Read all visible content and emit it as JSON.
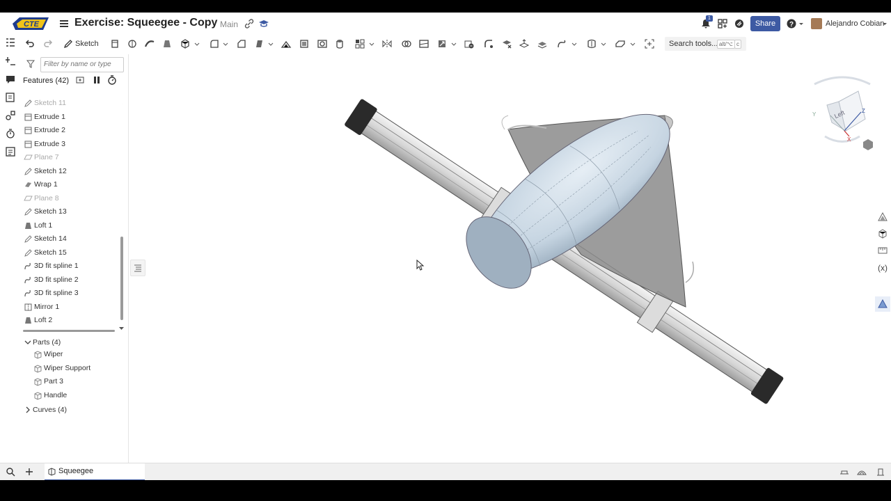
{
  "header": {
    "title": "Exercise: Squeegee - Copy",
    "branch": "Main",
    "share_label": "Share",
    "user_name": "Alejandro Cobian",
    "notification_count": "1",
    "logo_text": "CTE"
  },
  "toolbar": {
    "sketch_label": "Sketch",
    "search_label": "Search tools...",
    "shortcut_1": "alt/⌥",
    "shortcut_2": "c"
  },
  "panel": {
    "filter_placeholder": "Filter by name or type",
    "features_title": "Features (42)",
    "features": [
      {
        "label": "Sketch 11",
        "icon": "sketch-icon",
        "dim": true
      },
      {
        "label": "Extrude 1",
        "icon": "extrude-icon",
        "dim": false
      },
      {
        "label": "Extrude 2",
        "icon": "extrude-icon",
        "dim": false
      },
      {
        "label": "Extrude 3",
        "icon": "extrude-icon",
        "dim": false
      },
      {
        "label": "Plane 7",
        "icon": "plane-icon",
        "dim": true
      },
      {
        "label": "Sketch 12",
        "icon": "sketch-icon",
        "dim": false
      },
      {
        "label": "Wrap 1",
        "icon": "wrap-icon",
        "dim": false
      },
      {
        "label": "Plane 8",
        "icon": "plane-icon",
        "dim": true
      },
      {
        "label": "Sketch 13",
        "icon": "sketch-icon",
        "dim": false
      },
      {
        "label": "Loft 1",
        "icon": "loft-icon",
        "dim": false
      },
      {
        "label": "Sketch 14",
        "icon": "sketch-icon",
        "dim": false
      },
      {
        "label": "Sketch 15",
        "icon": "sketch-icon",
        "dim": false
      },
      {
        "label": "3D fit spline 1",
        "icon": "spline-icon",
        "dim": false
      },
      {
        "label": "3D fit spline 2",
        "icon": "spline-icon",
        "dim": false
      },
      {
        "label": "3D fit spline 3",
        "icon": "spline-icon",
        "dim": false
      },
      {
        "label": "Mirror 1",
        "icon": "mirror-icon",
        "dim": false
      },
      {
        "label": "Loft 2",
        "icon": "loft-icon",
        "dim": false
      }
    ],
    "parts_label": "Parts (4)",
    "parts": [
      "Wiper",
      "Wiper Support",
      "Part 3",
      "Handle"
    ],
    "curves_label": "Curves (4)"
  },
  "viewcube": {
    "face_label": "Left",
    "axis_x": "X",
    "axis_y": "Y",
    "axis_z": "Z"
  },
  "bottom": {
    "tab_label": "Squeegee"
  },
  "colors": {
    "accent": "#3d5aa3",
    "part_blue": "#c7d5e2",
    "part_gray": "#bdbdbd"
  }
}
